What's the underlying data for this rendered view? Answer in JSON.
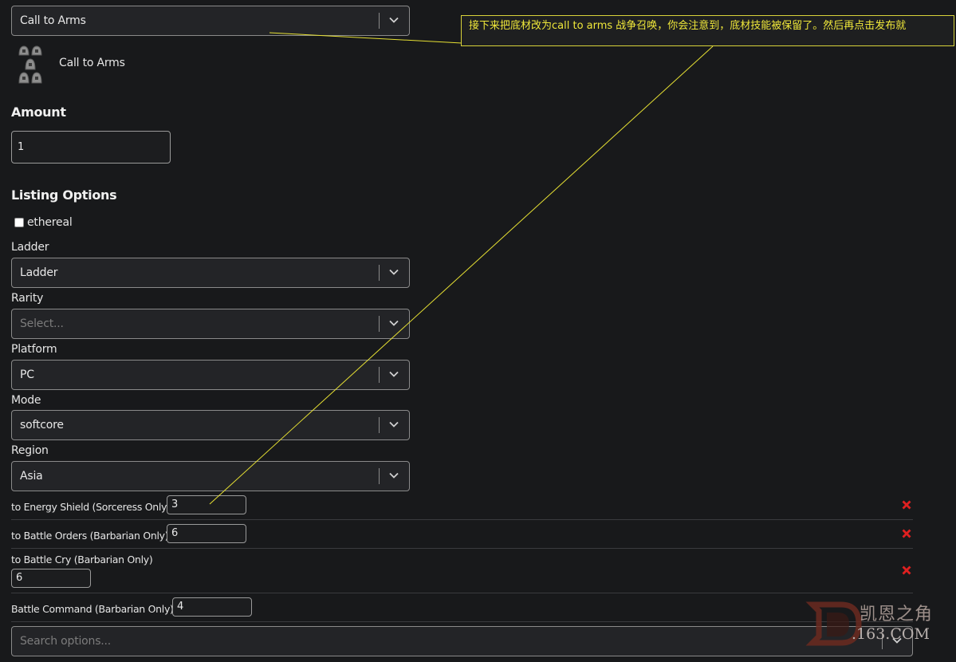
{
  "base_select": {
    "value": "Call to Arms"
  },
  "item_preview": {
    "name": "Call to Arms",
    "icon": "runeword-runes-icon"
  },
  "amount": {
    "heading": "Amount",
    "value": "1"
  },
  "listing": {
    "heading": "Listing Options",
    "ethereal_label": "ethereal",
    "ethereal_checked": false,
    "ladder": {
      "label": "Ladder",
      "value": "Ladder"
    },
    "rarity": {
      "label": "Rarity",
      "placeholder": "Select..."
    },
    "platform": {
      "label": "Platform",
      "value": "PC"
    },
    "mode": {
      "label": "Mode",
      "value": "softcore"
    },
    "region": {
      "label": "Region",
      "value": "Asia"
    }
  },
  "stats": [
    {
      "label": "to Energy Shield (Sorceress Only)",
      "value": "3"
    },
    {
      "label": "to Battle Orders (Barbarian Only)",
      "value": "6"
    },
    {
      "label": "to Battle Cry (Barbarian Only)",
      "value": "6"
    },
    {
      "label": "Battle Command (Barbarian Only)",
      "value": "4"
    }
  ],
  "search_options": {
    "placeholder": "Search options..."
  },
  "annotation": {
    "text": "接下来把底材改为call to arms 战争召唤，你会注意到，底材技能被保留了。然后再点击发布就"
  },
  "watermark": {
    "text": "凯恩之角",
    "sub": ".163.COM"
  },
  "colors": {
    "remove": "#e02020",
    "annotation": "#f0e83a",
    "background": "#18191b"
  }
}
